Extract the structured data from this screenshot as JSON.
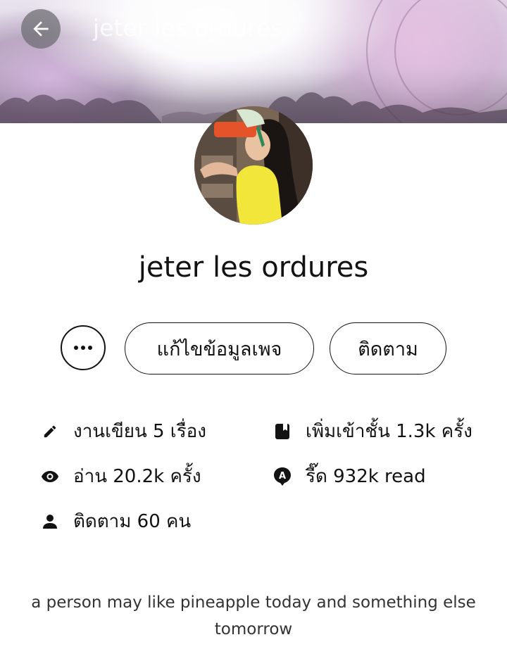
{
  "header": {
    "title": "jeter les ordures",
    "back_icon": "arrow-left-icon"
  },
  "profile": {
    "name": "jeter les ordures",
    "bio": "a person may like pineapple today and something else tomorrow"
  },
  "actions": {
    "more_icon": "more-horizontal-icon",
    "edit_label": "แก้ไขข้อมูลเพจ",
    "follow_label": "ติดตาม"
  },
  "stats": {
    "works": {
      "icon": "pencil-icon",
      "text": "งานเขียน 5 เรื่อง"
    },
    "added": {
      "icon": "book-icon",
      "text": "เพิ่มเข้าชั้น 1.3k ครั้ง"
    },
    "reads": {
      "icon": "eye-icon",
      "text": "อ่าน 20.2k ครั้ง"
    },
    "rid": {
      "icon": "rid-badge-icon",
      "text": "รี๊ด 932k read"
    },
    "followers": {
      "icon": "person-icon",
      "text": "ติดตาม 60 คน"
    }
  },
  "colors": {
    "text": "#121212",
    "bio_text": "#333333",
    "back_button_bg": "#6e6e73"
  }
}
